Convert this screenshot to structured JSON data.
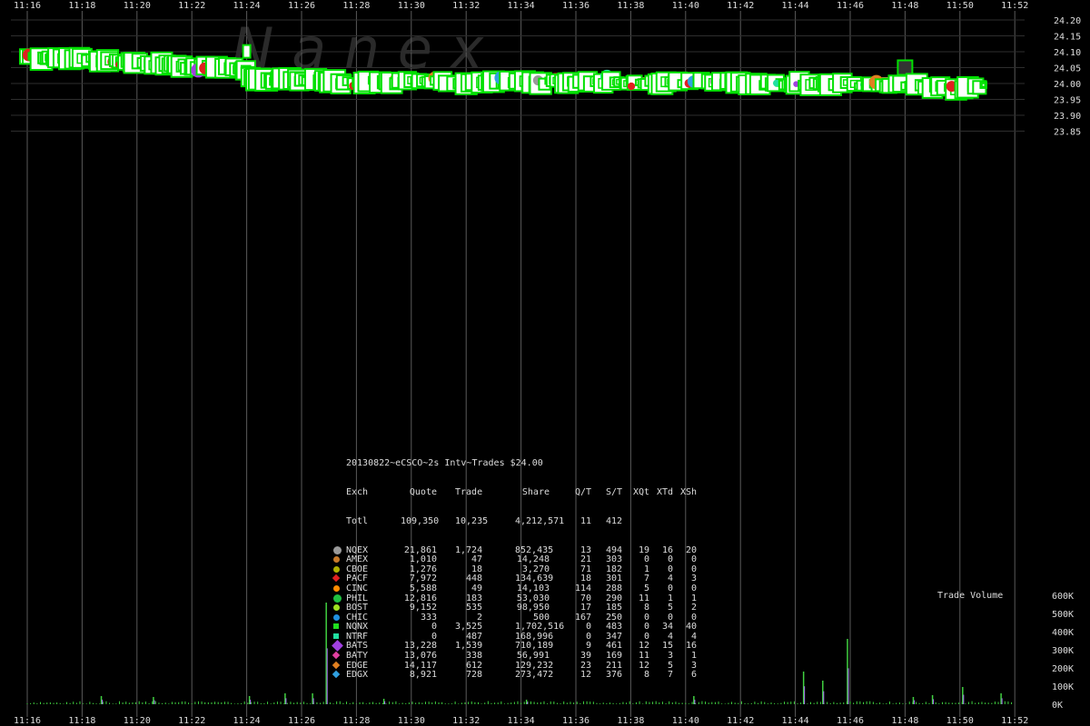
{
  "watermark": "N a n e x",
  "volume_label": "Trade Volume",
  "chart_data": {
    "type": "scatter",
    "title": "20130822~eCSCO~2s Intv~Trades $24.00",
    "x_ticks": [
      "11:16",
      "11:18",
      "11:20",
      "11:22",
      "11:24",
      "11:26",
      "11:28",
      "11:30",
      "11:32",
      "11:34",
      "11:36",
      "11:38",
      "11:40",
      "11:42",
      "11:44",
      "11:46",
      "11:48",
      "11:50",
      "11:52"
    ],
    "y_ticks": [
      "24.20",
      "24.15",
      "24.10",
      "24.05",
      "24.00",
      "23.95",
      "23.90",
      "23.85"
    ],
    "y_values": [
      24.2,
      24.15,
      24.1,
      24.05,
      24.0,
      23.95,
      23.9,
      23.85
    ],
    "volume_ticks": [
      "600K",
      "500K",
      "400K",
      "300K",
      "200K",
      "100K",
      "0K"
    ],
    "volume_values": [
      600000,
      500000,
      400000,
      300000,
      200000,
      100000,
      0
    ],
    "xlim_minutes": [
      0,
      36
    ],
    "ylim": [
      23.8,
      24.2
    ],
    "trade_path": [
      {
        "t": 0.0,
        "p": 24.085
      },
      {
        "t": 0.6,
        "p": 24.08
      },
      {
        "t": 1.2,
        "p": 24.082
      },
      {
        "t": 1.8,
        "p": 24.08
      },
      {
        "t": 2.5,
        "p": 24.075
      },
      {
        "t": 3.0,
        "p": 24.072
      },
      {
        "t": 3.8,
        "p": 24.068
      },
      {
        "t": 4.5,
        "p": 24.063
      },
      {
        "t": 5.2,
        "p": 24.058
      },
      {
        "t": 5.8,
        "p": 24.053
      },
      {
        "t": 6.5,
        "p": 24.052
      },
      {
        "t": 7.2,
        "p": 24.05
      },
      {
        "t": 7.8,
        "p": 24.048
      },
      {
        "t": 8.2,
        "p": 24.02
      },
      {
        "t": 8.8,
        "p": 24.013
      },
      {
        "t": 9.4,
        "p": 24.01
      },
      {
        "t": 10.0,
        "p": 24.013
      },
      {
        "t": 10.6,
        "p": 24.008
      },
      {
        "t": 11.2,
        "p": 24.003
      },
      {
        "t": 12.0,
        "p": 24.005
      },
      {
        "t": 13.0,
        "p": 24.004
      },
      {
        "t": 14.0,
        "p": 24.006
      },
      {
        "t": 15.0,
        "p": 24.003
      },
      {
        "t": 16.0,
        "p": 24.002
      },
      {
        "t": 17.0,
        "p": 24.004
      },
      {
        "t": 18.0,
        "p": 24.003
      },
      {
        "t": 19.0,
        "p": 24.004
      },
      {
        "t": 20.0,
        "p": 24.002
      },
      {
        "t": 21.0,
        "p": 24.003
      },
      {
        "t": 22.0,
        "p": 24.004
      },
      {
        "t": 23.0,
        "p": 24.002
      },
      {
        "t": 24.0,
        "p": 24.005
      },
      {
        "t": 25.0,
        "p": 24.003
      },
      {
        "t": 26.0,
        "p": 24.002
      },
      {
        "t": 27.0,
        "p": 24.0
      },
      {
        "t": 28.0,
        "p": 24.001
      },
      {
        "t": 29.0,
        "p": 23.998
      },
      {
        "t": 30.0,
        "p": 23.997
      },
      {
        "t": 31.0,
        "p": 23.995
      },
      {
        "t": 32.0,
        "p": 23.993
      },
      {
        "t": 33.0,
        "p": 23.99
      },
      {
        "t": 34.0,
        "p": 23.985
      },
      {
        "t": 35.0,
        "p": 23.99
      }
    ],
    "outlier_trades": [
      {
        "t": 8.0,
        "p": 24.101
      }
    ],
    "nbbo_band": {
      "t_start": 11.6,
      "t_end": 32.0,
      "bid": 24.007,
      "ask": 24.019
    },
    "spike": {
      "t": 32.0,
      "low": 24.01,
      "high": 24.068
    },
    "volume_spikes": [
      {
        "t": 10.9,
        "v": 560000
      },
      {
        "t": 28.3,
        "v": 180000
      },
      {
        "t": 29.0,
        "v": 130000
      },
      {
        "t": 29.9,
        "v": 360000
      },
      {
        "t": 34.1,
        "v": 95000
      },
      {
        "t": 2.7,
        "v": 45000
      },
      {
        "t": 4.6,
        "v": 40000
      },
      {
        "t": 8.1,
        "v": 45000
      },
      {
        "t": 9.4,
        "v": 60000
      },
      {
        "t": 10.4,
        "v": 60000
      },
      {
        "t": 13.0,
        "v": 30000
      },
      {
        "t": 18.2,
        "v": 25000
      },
      {
        "t": 24.3,
        "v": 45000
      },
      {
        "t": 32.3,
        "v": 40000
      },
      {
        "t": 33.0,
        "v": 50000
      },
      {
        "t": 35.5,
        "v": 60000
      }
    ],
    "stats_header": [
      "Exch",
      "Quote",
      "Trade",
      "Share",
      "Q/T",
      "S/T",
      "XQt",
      "XTd",
      "XSh"
    ],
    "stats_total": [
      "Totl",
      "109,350",
      "10,235",
      "4,212,571",
      "11",
      "412",
      "",
      "",
      ""
    ],
    "stats_rows": [
      {
        "exch": "NQEX",
        "quote": "21,861",
        "trade": "1,724",
        "share": "852,435",
        "qt": "13",
        "st": "494",
        "xqt": "19",
        "xtd": "16",
        "xsh": "20",
        "color": "#9a9a9a",
        "shape": "circle",
        "size": "big"
      },
      {
        "exch": "AMEX",
        "quote": "1,010",
        "trade": "47",
        "share": "14,248",
        "qt": "21",
        "st": "303",
        "xqt": "0",
        "xtd": "0",
        "xsh": "0",
        "color": "#c87a2a",
        "shape": "circle",
        "size": "small"
      },
      {
        "exch": "CBOE",
        "quote": "1,276",
        "trade": "18",
        "share": "3,270",
        "qt": "71",
        "st": "182",
        "xqt": "1",
        "xtd": "0",
        "xsh": "0",
        "color": "#b0b000",
        "shape": "circle",
        "size": "small"
      },
      {
        "exch": "PACF",
        "quote": "7,972",
        "trade": "448",
        "share": "134,639",
        "qt": "18",
        "st": "301",
        "xqt": "7",
        "xtd": "4",
        "xsh": "3",
        "color": "#e02020",
        "shape": "diamond",
        "size": "small"
      },
      {
        "exch": "CINC",
        "quote": "5,588",
        "trade": "49",
        "share": "14,103",
        "qt": "114",
        "st": "288",
        "xqt": "5",
        "xtd": "0",
        "xsh": "0",
        "color": "#ff8c00",
        "shape": "circle",
        "size": "small"
      },
      {
        "exch": "PHIL",
        "quote": "12,816",
        "trade": "183",
        "share": "53,030",
        "qt": "70",
        "st": "290",
        "xqt": "11",
        "xtd": "1",
        "xsh": "1",
        "color": "#20c040",
        "shape": "circle",
        "size": "big"
      },
      {
        "exch": "BOST",
        "quote": "9,152",
        "trade": "535",
        "share": "98,950",
        "qt": "17",
        "st": "185",
        "xqt": "8",
        "xtd": "5",
        "xsh": "2",
        "color": "#a0e020",
        "shape": "circle",
        "size": "small"
      },
      {
        "exch": "CHIC",
        "quote": "333",
        "trade": "2",
        "share": "500",
        "qt": "167",
        "st": "250",
        "xqt": "0",
        "xtd": "0",
        "xsh": "0",
        "color": "#2090e0",
        "shape": "circle",
        "size": "small"
      },
      {
        "exch": "NQNX",
        "quote": "0",
        "trade": "3,525",
        "share": "1,702,516",
        "qt": "0",
        "st": "483",
        "xqt": "0",
        "xtd": "34",
        "xsh": "40",
        "color": "#20e020",
        "shape": "square",
        "size": "small"
      },
      {
        "exch": "NTRF",
        "quote": "0",
        "trade": "487",
        "share": "168,996",
        "qt": "0",
        "st": "347",
        "xqt": "0",
        "xtd": "4",
        "xsh": "4",
        "color": "#20e0a0",
        "shape": "square",
        "size": "small"
      },
      {
        "exch": "BATS",
        "quote": "13,228",
        "trade": "1,539",
        "share": "710,189",
        "qt": "9",
        "st": "461",
        "xqt": "12",
        "xtd": "15",
        "xsh": "16",
        "color": "#a040e0",
        "shape": "diamond",
        "size": "big"
      },
      {
        "exch": "BATY",
        "quote": "13,076",
        "trade": "338",
        "share": "56,991",
        "qt": "39",
        "st": "169",
        "xqt": "11",
        "xtd": "3",
        "xsh": "1",
        "color": "#e040a0",
        "shape": "diamond",
        "size": "small"
      },
      {
        "exch": "EDGE",
        "quote": "14,117",
        "trade": "612",
        "share": "129,232",
        "qt": "23",
        "st": "211",
        "xqt": "12",
        "xtd": "5",
        "xsh": "3",
        "color": "#e08020",
        "shape": "diamond",
        "size": "small"
      },
      {
        "exch": "EDGX",
        "quote": "8,921",
        "trade": "728",
        "share": "273,472",
        "qt": "12",
        "st": "376",
        "xqt": "8",
        "xtd": "7",
        "xsh": "6",
        "color": "#30a0e0",
        "shape": "diamond",
        "size": "small"
      }
    ],
    "colors": {
      "background": "#000000",
      "grid": "#5a5a5a",
      "trade_fill": "#ffffff",
      "trade_edge": "#00e000",
      "nbbo": "#f4f46c",
      "spike": "#f06a6a",
      "volume": "#40d040",
      "volume_spike": "#b070ff"
    }
  }
}
